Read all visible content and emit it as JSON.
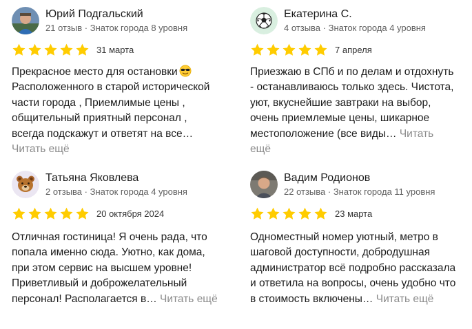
{
  "read_more_label": "Читать ещё",
  "colors": {
    "star": "#ffcc00",
    "read_more": "#8a8a8a",
    "meta": "#5f5f5f"
  },
  "reviews": [
    {
      "author": "Юрий Подгальский",
      "meta": "21 отзыв · Знаток города 8 уровня",
      "date": "31 марта",
      "rating": 5,
      "avatar": "photo",
      "text_before": "Прекрасное место для остановки",
      "text_icon": "smiling-face-with-sunglasses-icon",
      "text": "Расположенного в старой исторической части города , Приемлимые цены , общительный приятный персонал , всегда подскажут и ответят на все…"
    },
    {
      "author": "Екатерина С.",
      "meta": "4 отзыва · Знаток города 4 уровня",
      "date": "7 апреля",
      "rating": 5,
      "avatar": "soccer-ball-icon",
      "text": "Приезжаю в СПб и по делам и отдохнуть - останавливаюсь только здесь. Чистота, уют, вкуснейшие завтраки на выбор, очень приемлемые цены, шикарное местоположение (все виды…"
    },
    {
      "author": "Татьяна Яковлева",
      "meta": "2 отзыва · Знаток города 4 уровня",
      "date": "20 октября 2024",
      "rating": 5,
      "avatar": "bear-face-icon",
      "text": "Отличная гостиница! Я очень рада, что попала именно сюда. Уютно, как дома, при этом сервис на высшем уровне! Приветливый и доброжелательный персонал! Располагается в…"
    },
    {
      "author": "Вадим Родионов",
      "meta": "22 отзыва · Знаток города 11 уровня",
      "date": "23 марта",
      "rating": 5,
      "avatar": "photo",
      "text": "Одноместный номер уютный, метро в шаговой доступности, добродушная администратор всё подробно рассказала и ответила на вопросы, очень удобно что в стоимость включены…"
    }
  ]
}
